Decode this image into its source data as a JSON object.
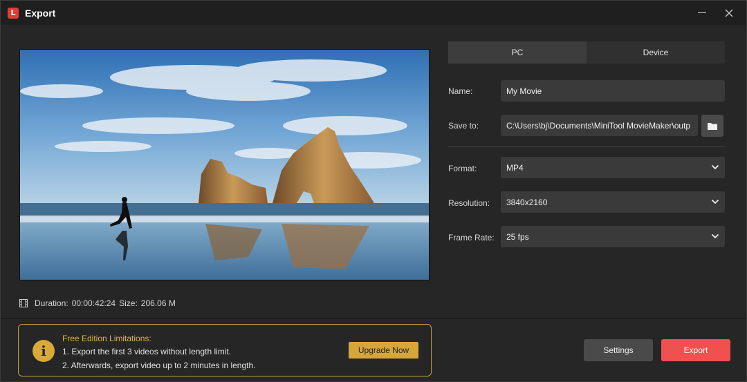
{
  "window": {
    "title": "Export",
    "logo_glyph": "L",
    "minimize_icon": "minimize-icon",
    "close_icon": "close-icon"
  },
  "preview": {
    "image": "beach-rock-arch-runner-landscape"
  },
  "info": {
    "duration_label": "Duration:",
    "duration_value": "00:00:42:24",
    "size_label": "Size:",
    "size_value": "206.06 M"
  },
  "tabs": [
    {
      "label": "PC",
      "active": true
    },
    {
      "label": "Device",
      "active": false
    }
  ],
  "form": {
    "name_label": "Name:",
    "name_value": "My Movie",
    "save_label": "Save to:",
    "save_value": "C:\\Users\\bj\\Documents\\MiniTool MovieMaker\\outp",
    "format_label": "Format:",
    "format_value": "MP4",
    "resolution_label": "Resolution:",
    "resolution_value": "3840x2160",
    "framerate_label": "Frame Rate:",
    "framerate_value": "25 fps"
  },
  "limitations": {
    "title": "Free Edition Limitations:",
    "line1": "1. Export the first 3 videos without length limit.",
    "line2": "2. Afterwards, export video up to 2 minutes in length.",
    "upgrade_label": "Upgrade Now"
  },
  "actions": {
    "settings_label": "Settings",
    "export_label": "Export"
  },
  "colors": {
    "accent_export": "#f0504e",
    "accent_gold": "#d7a63a",
    "background": "#262626"
  }
}
